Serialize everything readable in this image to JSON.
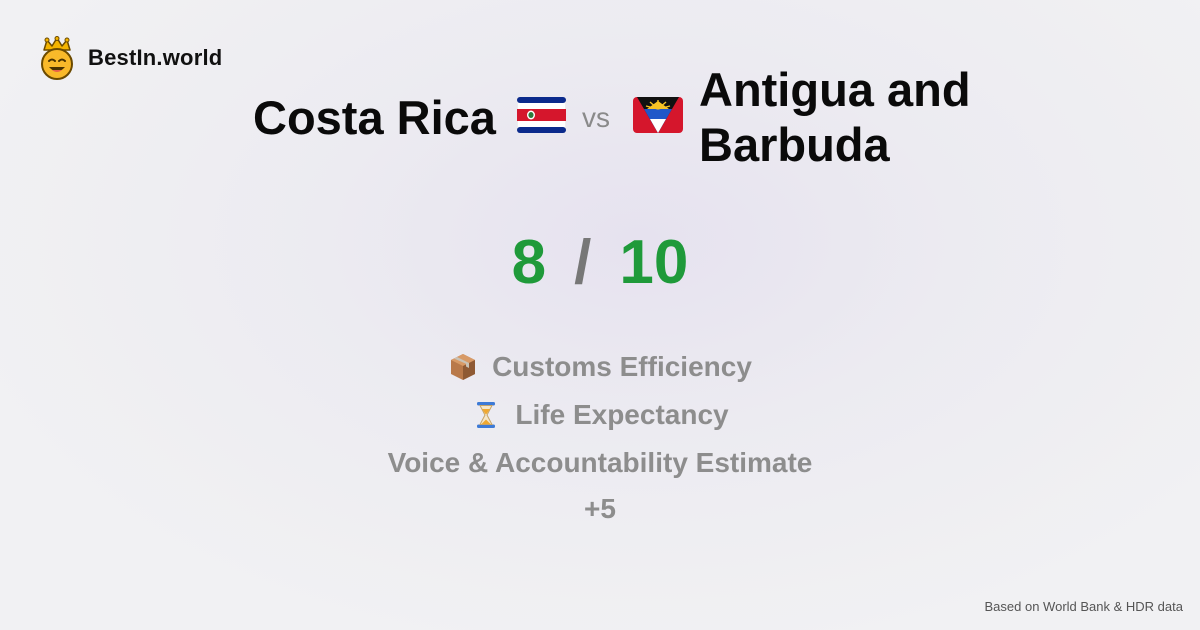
{
  "brand": {
    "name": "BestIn.world",
    "logo_icon": "crowned-smiley-icon"
  },
  "comparison": {
    "country_a": "Costa Rica",
    "flag_a_icon": "costa-rica-flag-icon",
    "vs_label": "vs",
    "country_b": "Antigua and Barbuda",
    "flag_b_icon": "antigua-and-barbuda-flag-icon"
  },
  "score": {
    "a": "8",
    "separator": "/",
    "b": "10",
    "color": "#1f9a3a"
  },
  "metrics": [
    {
      "label": "Customs Efficiency",
      "icon": "package-icon"
    },
    {
      "label": "Life Expectancy",
      "icon": "hourglass-icon"
    },
    {
      "label": "Voice & Accountability Estimate",
      "icon": ""
    }
  ],
  "more_label": "+5",
  "footer": "Based on World Bank & HDR data"
}
